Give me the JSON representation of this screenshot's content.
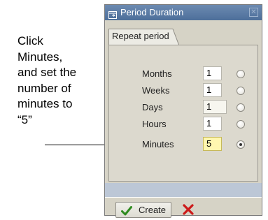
{
  "callout": {
    "text": "Click\nMinutes,\nand set the\nnumber of\nminutes to\n“5”"
  },
  "dialog": {
    "title": "Period Duration",
    "tab_label": "Repeat period",
    "rows": [
      {
        "label": "Months",
        "value": "1",
        "selected": false
      },
      {
        "label": "Weeks",
        "value": "1",
        "selected": false
      },
      {
        "label": "Days",
        "value": "1",
        "selected": false
      },
      {
        "label": "Hours",
        "value": "1",
        "selected": false
      },
      {
        "label": "Minutes",
        "value": "5",
        "selected": true
      }
    ],
    "create_label": "Create",
    "colors": {
      "titlebar": "#5a7aa5",
      "dialog_bg": "#d6d3c6",
      "highlight_field": "#fff7b0",
      "check_green": "#2e8b1f",
      "cancel_red": "#cc1a1a"
    },
    "icons": {
      "title": "window-icon",
      "close": "close-icon",
      "create": "checkmark-icon",
      "cancel": "cancel-x-icon"
    }
  }
}
